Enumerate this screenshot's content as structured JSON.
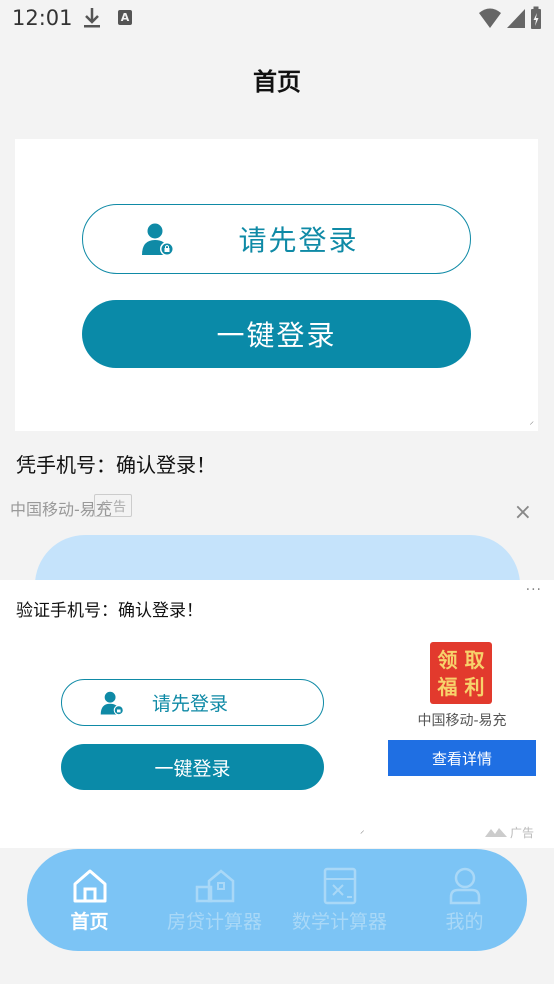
{
  "status_bar": {
    "time": "12:01",
    "a_badge": "A"
  },
  "header": {
    "title": "首页"
  },
  "login_card": {
    "outline_button_label": "请先登录",
    "filled_button_label": "一键登录"
  },
  "confirm_text": "凭手机号：确认登录！",
  "ad_band": {
    "brand": "中国移动-易充",
    "tag": "广告",
    "close": "×"
  },
  "ad_overlay": {
    "more": "···",
    "message": "验证手机号：确认登录！",
    "outline_button_label": "请先登录",
    "filled_button_label": "一键登录",
    "badge_chars": [
      "领",
      "取",
      "福",
      "利"
    ],
    "advertiser": "中国移动-易充",
    "detail_button": "查看详情",
    "footer_tag": "广告"
  },
  "tab_bar": {
    "tabs": [
      {
        "label": "首页",
        "active": true
      },
      {
        "label": "房贷计算器",
        "active": false
      },
      {
        "label": "数学计算器",
        "active": false
      },
      {
        "label": "我的",
        "active": false
      }
    ]
  },
  "colors": {
    "primary": "#0a8aa8",
    "tab_bar": "#7cc4f5",
    "ad_button": "#1f6fe3",
    "badge": "#e23a2d"
  }
}
